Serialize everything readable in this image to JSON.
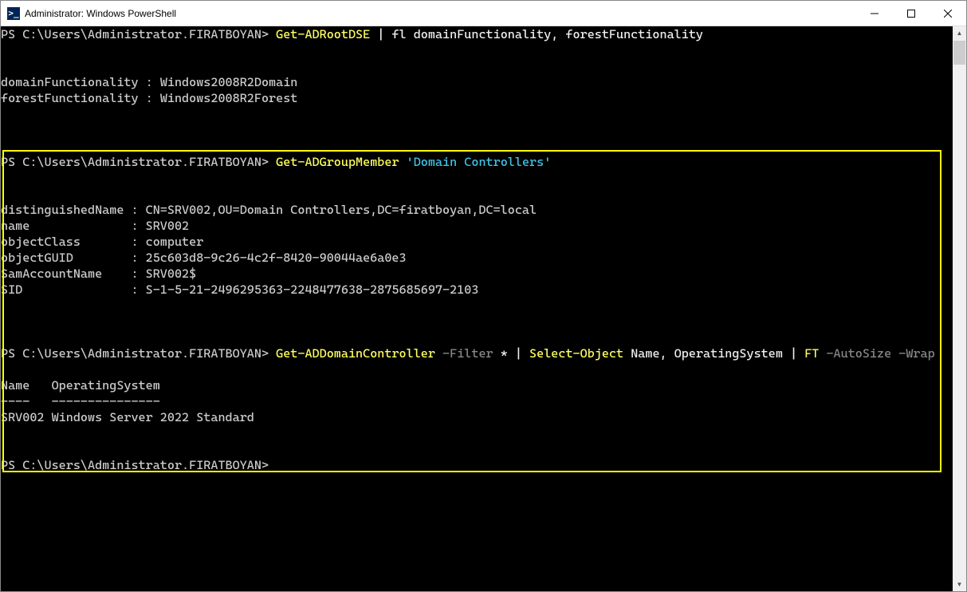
{
  "titlebar": {
    "icon_glyph": ">_",
    "title": "Administrator: Windows PowerShell"
  },
  "prompt": "PS C:\\Users\\Administrator.FIRATBOYAN>",
  "cmd1": {
    "cmdlet": "Get-ADRootDSE",
    "pipe": " | ",
    "fl": "fl ",
    "args": "domainFunctionality, forestFunctionality"
  },
  "out1": {
    "domainFunctionality_label": "domainFunctionality : ",
    "domainFunctionality_value": "Windows2008R2Domain",
    "forestFunctionality_label": "forestFunctionality : ",
    "forestFunctionality_value": "Windows2008R2Forest"
  },
  "cmd2": {
    "cmdlet": "Get-ADGroupMember",
    "arg": " 'Domain Controllers'"
  },
  "out2": {
    "distinguishedName_label": "distinguishedName : ",
    "distinguishedName_value": "CN=SRV002,OU=Domain Controllers,DC=firatboyan,DC=local",
    "name_label": "name              : ",
    "name_value": "SRV002",
    "objectClass_label": "objectClass       : ",
    "objectClass_value": "computer",
    "objectGUID_label": "objectGUID        : ",
    "objectGUID_value": "25c603d8-9c26-4c2f-8420-90044ae6a0e3",
    "SamAccountName_label": "SamAccountName    : ",
    "SamAccountName_value": "SRV002$",
    "SID_label": "SID               : ",
    "SID_value": "S-1-5-21-2496295363-2248477638-2875685697-2103"
  },
  "cmd3": {
    "cmdlet": "Get-ADDomainController",
    "filter": " -Filter ",
    "star": "* ",
    "pipe1": "| ",
    "select": "Select-Object ",
    "select_args": "Name, OperatingSystem ",
    "pipe2": "| ",
    "ft": "FT",
    "ft_args": " -AutoSize -Wrap"
  },
  "out3": {
    "header": "Name   OperatingSystem",
    "divider": "----   ---------------",
    "row": "SRV002 Windows Server 2022 Standard"
  }
}
